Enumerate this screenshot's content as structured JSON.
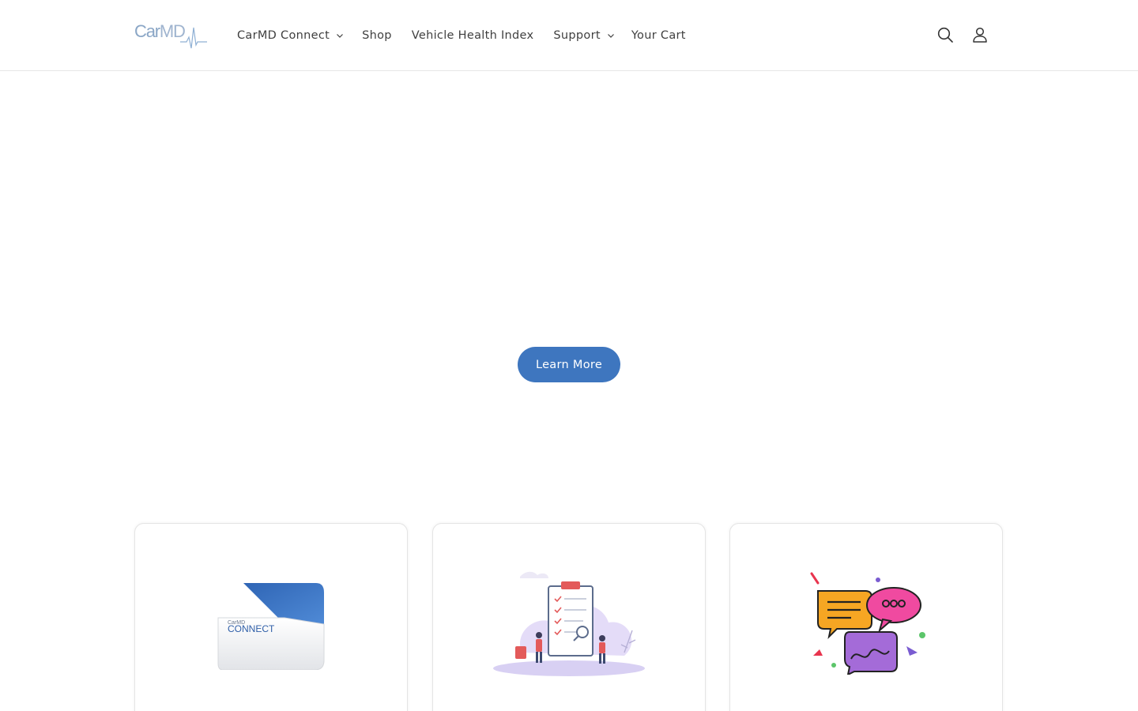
{
  "header": {
    "logo_text_car": "Car",
    "logo_text_md": "MD",
    "nav": [
      {
        "label": "CarMD Connect",
        "has_dropdown": true
      },
      {
        "label": "Shop",
        "has_dropdown": false
      },
      {
        "label": "Vehicle Health Index",
        "has_dropdown": false
      },
      {
        "label": "Support",
        "has_dropdown": true
      },
      {
        "label": "Your Cart",
        "has_dropdown": false
      }
    ],
    "icons": [
      "search-icon",
      "account-icon"
    ]
  },
  "hero": {
    "button_label": "Learn More"
  },
  "cards": [
    {
      "image": "carmd-connect-device",
      "device_brand": "CarMD",
      "device_label": "CONNECT"
    },
    {
      "image": "checklist-illustration"
    },
    {
      "image": "chat-bubbles-illustration"
    }
  ],
  "colors": {
    "accent": "#3e76bf",
    "text": "#3f3f3f",
    "border": "#e4e4e4",
    "logo": "#8aa6c6"
  }
}
